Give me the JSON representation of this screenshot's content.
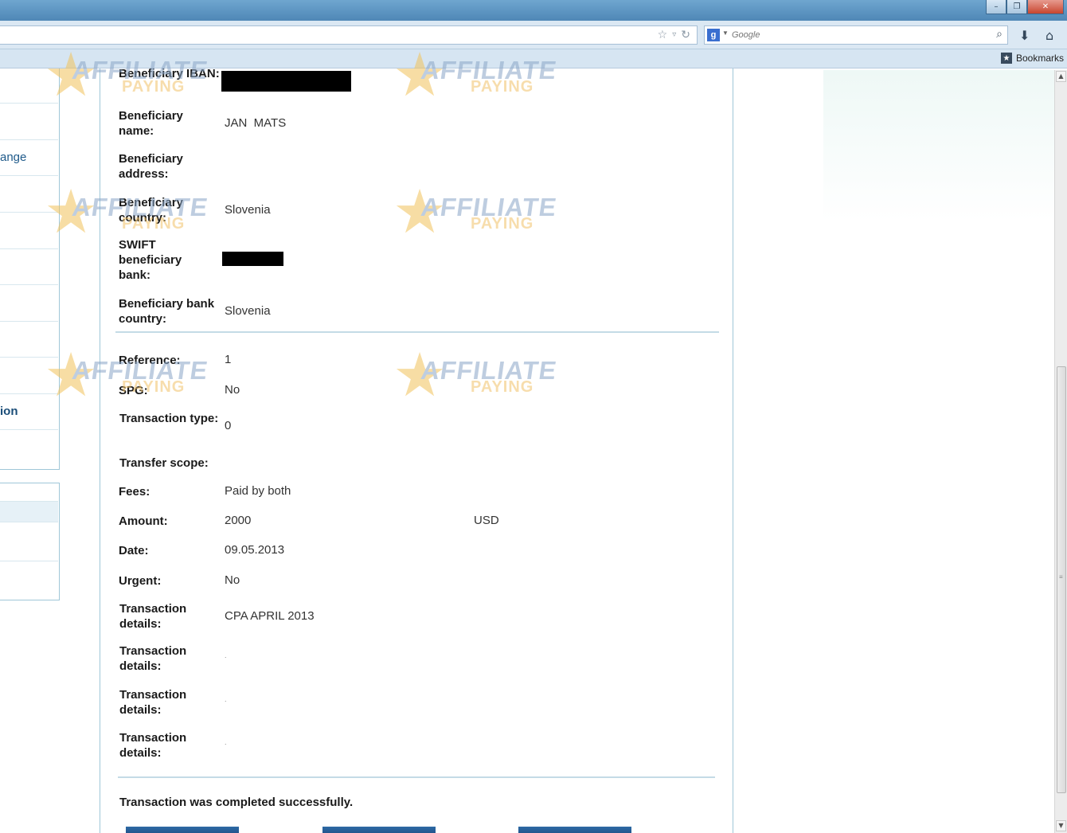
{
  "browser": {
    "search_placeholder": "Google",
    "search_engine_badge": "g",
    "bookmarks_label": "Bookmarks",
    "icons": {
      "star": "bookmark-star-icon",
      "dropdown": "history-dropdown-icon",
      "reload": "reload-icon",
      "search": "search-icon",
      "download": "download-icon",
      "home": "home-icon"
    }
  },
  "sidebar": {
    "items": [
      {
        "label": "ange"
      },
      {
        "label": "ion"
      }
    ]
  },
  "watermark": {
    "line1": "AFFILIATE",
    "line2": "PAYING"
  },
  "beneficiary": {
    "iban_label": "Beneficiary IBAN:",
    "name_label": "Beneficiary name:",
    "name_value": "JAN  MATS",
    "address_label": "Beneficiary address:",
    "address_value": "",
    "country_label": "Beneficiary country:",
    "country_value": "Slovenia",
    "swift_label": "SWIFT beneficiary bank:",
    "bank_country_label": "Beneficiary bank country:",
    "bank_country_value": "Slovenia"
  },
  "transaction": {
    "reference_label": "Reference:",
    "reference_value": "1",
    "spg_label": "SPG:",
    "spg_value": "No",
    "type_label": "Transaction type:",
    "type_value": "0",
    "scope_label": "Transfer scope:",
    "scope_value": "",
    "fees_label": "Fees:",
    "fees_value": "Paid by both",
    "amount_label": "Amount:",
    "amount_value": "2000",
    "currency": "USD",
    "date_label": "Date:",
    "date_value": "09.05.2013",
    "urgent_label": "Urgent:",
    "urgent_value": "No",
    "details": [
      {
        "label": "Transaction details:",
        "value": "CPA APRIL 2013"
      },
      {
        "label": "Transaction details:",
        "value": "."
      },
      {
        "label": "Transaction details:",
        "value": "."
      },
      {
        "label": "Transaction details:",
        "value": "."
      }
    ]
  },
  "status_message": "Transaction was completed successfully."
}
